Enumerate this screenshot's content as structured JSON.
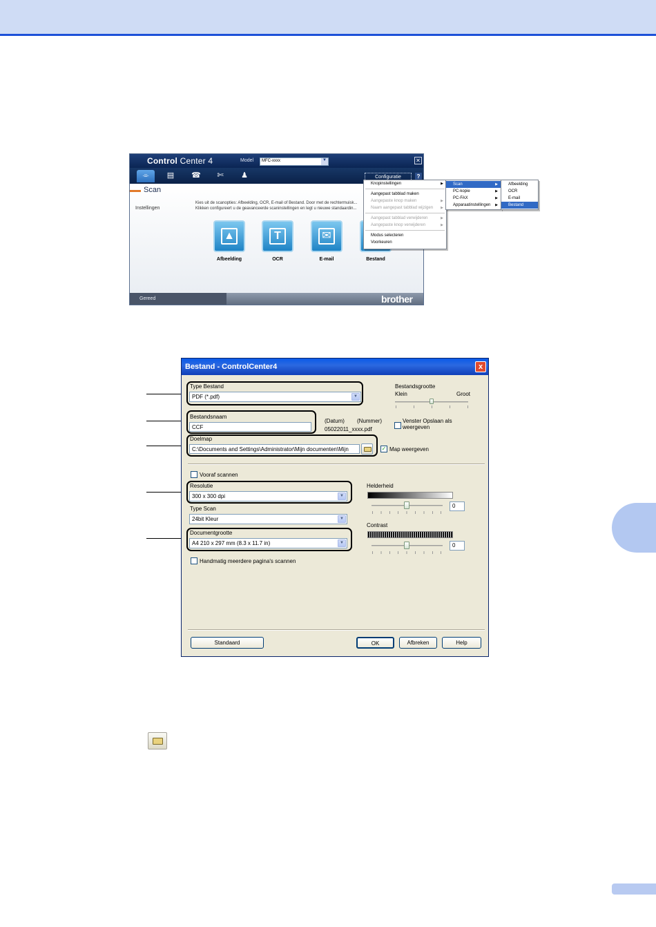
{
  "controlcenter": {
    "logo_bold": "Control",
    "logo_thin": " Center 4",
    "model_label": "Model",
    "model_value": "MFC-xxxx",
    "configuratie": "Configuratie",
    "help": "?",
    "section_title": "Scan",
    "instellingen": "Instellingen",
    "description": "Kies uit de scanopties: Afbeelding, OCR, E-mail of Bestand. Door met de rechtermuisk... Klikken configureert u de geavanceerde scaninstellingen en legt u nieuwe standaardin...",
    "buttons": [
      "Afbeelding",
      "OCR",
      "E-mail",
      "Bestand"
    ],
    "status": "Gereed",
    "brand": "brother"
  },
  "menu_main": {
    "items": [
      {
        "label": "Knopinstellingen",
        "state": "selected",
        "submenu": true
      },
      {
        "label": "Aangepast tabblad maken",
        "state": "normal",
        "submenu": false
      },
      {
        "label": "Aangepaste knop maken",
        "state": "disabled",
        "submenu": true
      },
      {
        "label": "Naam aangepast tabblad wijzigen",
        "state": "disabled",
        "submenu": true
      },
      {
        "label": "Aangepast tabblad verwijderen",
        "state": "disabled",
        "submenu": true
      },
      {
        "label": "Aangepaste knop verwijderen",
        "state": "disabled",
        "submenu": true
      },
      {
        "label": "Modus selecteren",
        "state": "normal",
        "submenu": false
      },
      {
        "label": "Voorkeuren",
        "state": "normal",
        "submenu": false
      }
    ]
  },
  "menu_sub": {
    "items": [
      {
        "label": "Scan",
        "state": "selected"
      },
      {
        "label": "PC-kopie",
        "state": "normal"
      },
      {
        "label": "PC-FAX",
        "state": "normal"
      },
      {
        "label": "Apparaatinstellingen",
        "state": "normal"
      }
    ]
  },
  "menu_scan": {
    "items": [
      {
        "label": "Afbeelding",
        "state": "normal"
      },
      {
        "label": "OCR",
        "state": "normal"
      },
      {
        "label": "E-mail",
        "state": "normal"
      },
      {
        "label": "Bestand",
        "state": "selected"
      }
    ]
  },
  "dialog": {
    "title": "Bestand - ControlCenter4",
    "close": "x",
    "type_bestand_label": "Type Bestand",
    "type_bestand_value": "PDF (*.pdf)",
    "bestandsgrootte_label": "Bestandsgrootte",
    "klein": "Klein",
    "groot": "Groot",
    "bestandsgrootte_level": 0.5,
    "bestandsnaam_label": "Bestandsnaam",
    "bestandsnaam_value": "CCF",
    "datum": "(Datum)",
    "nummer": "(Nummer)",
    "naam_voorbeeld": "05022011_xxxx.pdf",
    "venster_opslaan": "Venster Opslaan als weergeven",
    "venster_opslaan_checked": false,
    "doelmap_label": "Doelmap",
    "doelmap_value": "C:\\Documents and Settings\\Administrator\\Mijn documenten\\Mijn",
    "map_weergeven": "Map weergeven",
    "map_weergeven_checked": true,
    "vooraf_scannen": "Vooraf scannen",
    "vooraf_checked": false,
    "resolutie_label": "Resolutie",
    "resolutie_value": "300 x 300 dpi",
    "helderheid_label": "Helderheid",
    "helderheid_value": "0",
    "type_scan_label": "Type Scan",
    "type_scan_value": "24bit Kleur",
    "contrast_label": "Contrast",
    "contrast_value": "0",
    "documentgrootte_label": "Documentgrootte",
    "documentgrootte_value": "A4 210 x 297 mm (8.3 x 11.7 in)",
    "handmatig": "Handmatig meerdere pagina's scannen",
    "handmatig_checked": false,
    "btn_standaard": "Standaard",
    "btn_ok": "OK",
    "btn_afbreken": "Afbreken",
    "btn_help": "Help"
  },
  "colors": {
    "top_band": "#cfdcf5",
    "top_rule": "#1c50d8",
    "side_tab": "#b3c8f1",
    "menu_highlight": "#316ac5",
    "xp_title": "#0a5ae8"
  }
}
